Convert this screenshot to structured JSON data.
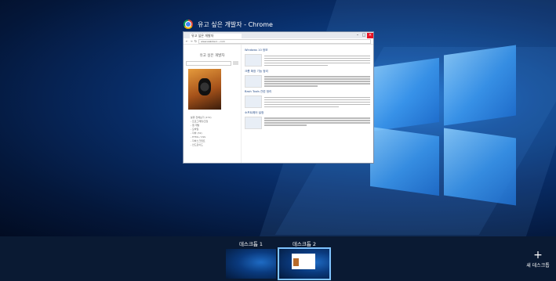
{
  "window": {
    "title": "유고 싶은 개발자 - Chrome",
    "tab_label": "유고 싶은 개발자",
    "url": "www.webdevl....com",
    "blog_title": "유고 싶은 개발자",
    "side_list": [
      "분류 전체보기 (172)",
      "- 프로그래밍/코딩",
      "- 웹 개발",
      "- 모바일",
      "- 자바 (32)",
      "- HTML / CSS",
      "- 자바스크립트",
      "- 안드로이드"
    ],
    "posts": [
      "Windows 10 정보",
      "크롬 확장 기능 정리",
      "Bash Tools 관련 정리",
      "소프트웨어 설정"
    ]
  },
  "task_view": {
    "desktops": [
      {
        "label": "데스크톱 1"
      },
      {
        "label": "데스크톱 2"
      }
    ],
    "new_desktop_label": "새 데스크톱"
  }
}
